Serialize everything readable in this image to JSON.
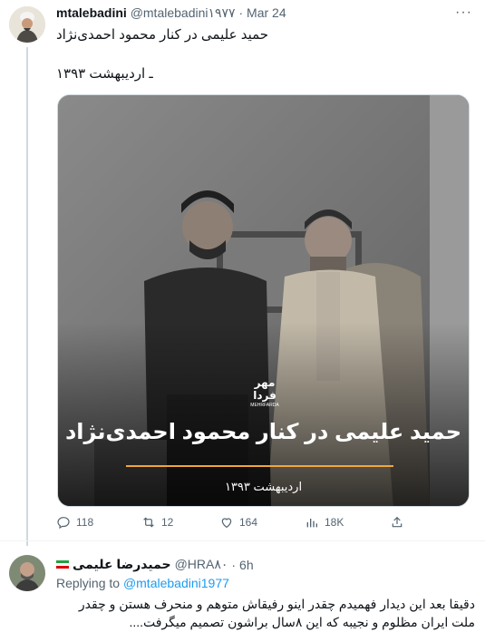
{
  "tweet": {
    "display_name": "mtalebadini",
    "handle": "@mtalebadini۱۹۷۷",
    "separator": "·",
    "time": "Mar 24",
    "more": "···",
    "text": "حمید علیمی در کنار محمود احمدی‌نژاد",
    "date_line": "ـ اردیبهشت ۱۳۹۳",
    "image": {
      "logo_text": "مهر فردا",
      "logo_sub": "MEHRFARDA",
      "caption_title": "حمید علیمی در کنار محمود احمدی‌نژاد",
      "caption_date": "اردیبهشت ۱۳۹۳"
    },
    "actions": {
      "replies": "118",
      "retweets": "12",
      "likes": "164",
      "views": "18K"
    }
  },
  "reply": {
    "display_name": "حمیدرضا علیمی",
    "handle": "@HRA۸۰",
    "separator": "·",
    "time": "6h",
    "replying_prefix": "Replying to",
    "replying_to": "@mtalebadini1977",
    "text": "دقیقا بعد این دیدار فهمیدم چقدر اینو رفیقاش متوهم و منحرف هستن و چقدر ملت ایران مظلوم و نجیبه که این ۸سال براشون تصمیم میگرفت...."
  },
  "colors": {
    "accent": "#1d9bf0",
    "secondary_text": "#536471",
    "caption_bar": "#f0a63a"
  }
}
